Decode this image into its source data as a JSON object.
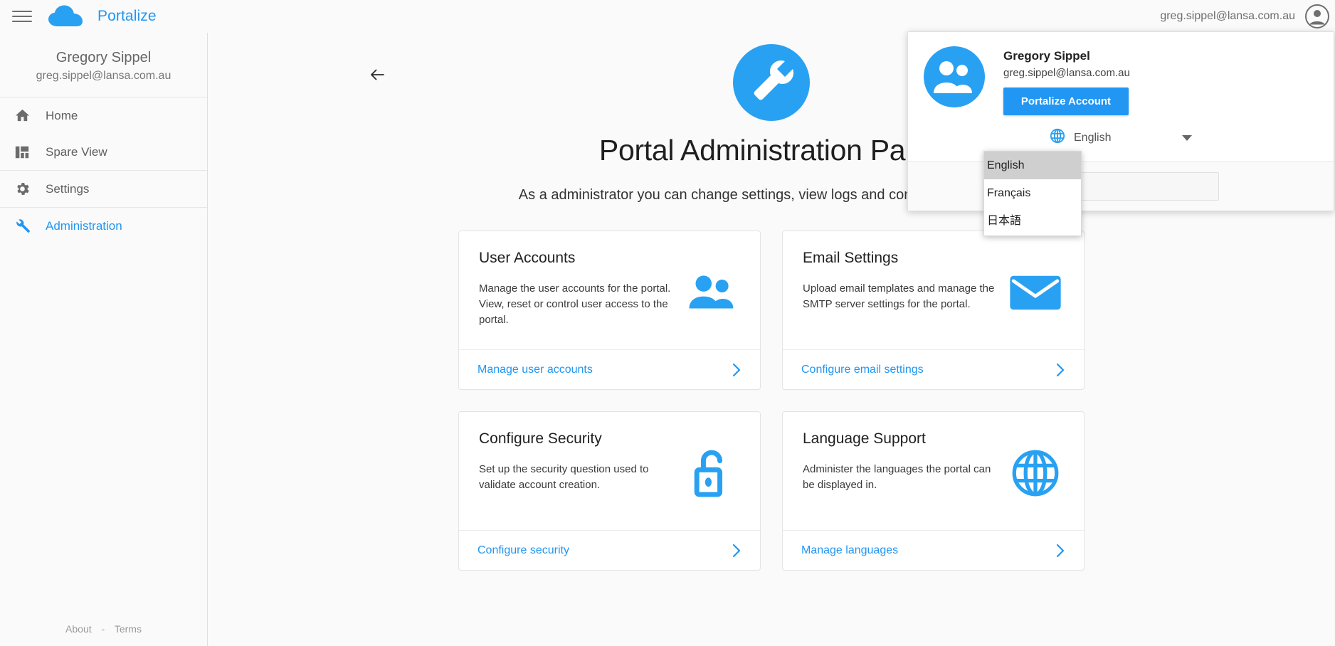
{
  "topbar": {
    "menu_icon": "hamburger-menu-icon",
    "logo_icon": "cloud-logo-icon",
    "brand": "Portalize",
    "email": "greg.sippel@lansa.com.au",
    "avatar_icon": "account-circle-icon"
  },
  "sidebar": {
    "profile": {
      "name": "Gregory Sippel",
      "email": "greg.sippel@lansa.com.au"
    },
    "items": [
      {
        "label": "Home",
        "icon": "home-icon",
        "active": false
      },
      {
        "label": "Spare View",
        "icon": "dashboard-icon",
        "active": false
      },
      {
        "label": "Settings",
        "icon": "gear-icon",
        "active": false
      },
      {
        "label": "Administration",
        "icon": "wrench-icon",
        "active": true
      }
    ],
    "footer": {
      "about": "About",
      "separator": "-",
      "terms": "Terms"
    }
  },
  "main": {
    "back_icon": "back-arrow-icon",
    "hero_icon": "wrench-circle-icon",
    "title": "Portal Administration Panel",
    "subtitle": "As a administrator you can change settings, view logs and control user accounts",
    "cards": [
      {
        "title": "User Accounts",
        "desc": "Manage the user accounts for the portal. View, reset or control user access to the portal.",
        "icon": "people-icon",
        "link": "Manage user accounts"
      },
      {
        "title": "Email Settings",
        "desc": "Upload email templates and manage the SMTP server settings for the portal.",
        "icon": "envelope-icon",
        "link": "Configure email settings"
      },
      {
        "title": "Configure Security",
        "desc": "Set up the security question used to validate account creation.",
        "icon": "open-lock-icon",
        "link": "Configure security"
      },
      {
        "title": "Language Support",
        "desc": "Administer the languages the portal can be displayed in.",
        "icon": "globe-icon",
        "link": "Manage languages"
      }
    ]
  },
  "user_menu": {
    "avatar_icon": "people-avatar-icon",
    "name": "Gregory Sippel",
    "email": "greg.sippel@lansa.com.au",
    "account_button": "Portalize Account",
    "language_icon": "globe-icon",
    "language_selected": "English",
    "language_options": [
      "English",
      "Français",
      "日本語"
    ]
  },
  "colors": {
    "accent": "#2196f3",
    "page_bg": "#fafafa",
    "card_bg": "#ffffff",
    "border": "#e0e0e0",
    "text": "#1f1f1f",
    "muted": "#6e6e6e",
    "dropdown_selected_bg": "#cfcfcf"
  }
}
